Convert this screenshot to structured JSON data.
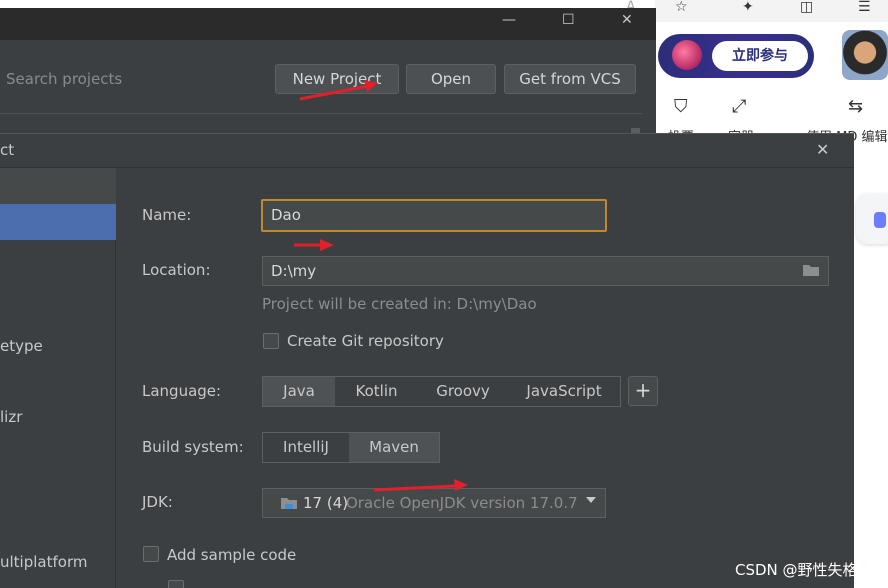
{
  "colors": {
    "ide_bg": "#3c3f41",
    "accent_selection": "#4b6eaf",
    "focus_border": "#c08a2c",
    "annotation_arrow": "#e0202b"
  },
  "browser": {
    "top_icons": [
      "text-size-icon",
      "star-icon",
      "extensions-icon",
      "split-screen-icon",
      "favorites-icon"
    ],
    "top_text": "A",
    "promo_button": "立即参与",
    "toolbar_labels": [
      "投票",
      "容器",
      "使用 MD 编辑"
    ]
  },
  "welcome": {
    "search_placeholder": "Search projects",
    "buttons": {
      "new_project": "New Project",
      "open": "Open",
      "get_from_vcs": "Get from VCS"
    },
    "window_controls": {
      "minimize": "—",
      "maximize": "☐",
      "close": "✕"
    }
  },
  "dialog": {
    "title": "ct",
    "close": "✕",
    "left_items": [
      "etype",
      "lizr",
      "ultiplatform"
    ],
    "name": {
      "label": "Name:",
      "value": "Dao"
    },
    "location": {
      "label": "Location:",
      "value": "D:\\my"
    },
    "hint": "Project will be created in: D:\\my\\Dao",
    "git_checkbox": "Create Git repository",
    "language": {
      "label": "Language:",
      "options": [
        "Java",
        "Kotlin",
        "Groovy",
        "JavaScript"
      ],
      "selected": "Java",
      "add": "+"
    },
    "build_system": {
      "label": "Build system:",
      "options": [
        "IntelliJ",
        "Maven"
      ],
      "selected": "Maven"
    },
    "jdk": {
      "label": "JDK:",
      "version": "17 (4)",
      "description": "Oracle OpenJDK version 17.0.7"
    },
    "sample_code_checkbox": "Add sample code"
  },
  "watermark": "CSDN @野性失格"
}
